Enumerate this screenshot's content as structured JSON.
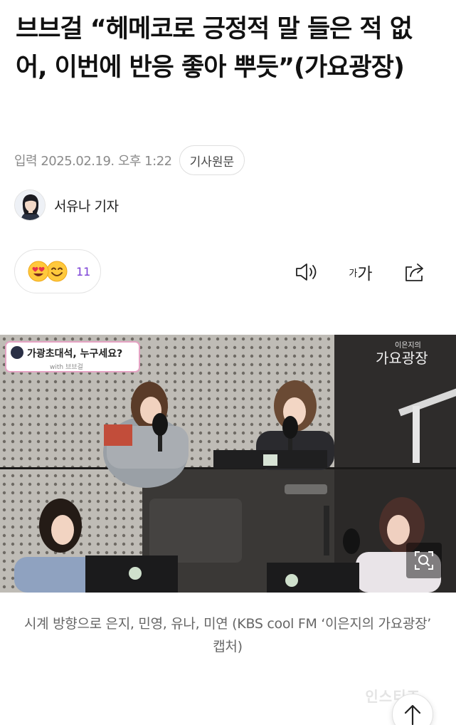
{
  "article": {
    "headline": "브브걸 “헤메코로 긍정적 말 들은 적 없어, 이번에 반응 좋아 뿌듯”(가요광장)",
    "date": "입력 2025.02.19. 오후 1:22",
    "source_button": "기사원문"
  },
  "author": {
    "name": "서유나 기자",
    "avatar_icon": "reporter-avatar"
  },
  "reactions": {
    "count": "11",
    "emoji_icons": [
      "heart-eyes-emoji-icon",
      "grinning-emoji-icon"
    ]
  },
  "toolbar": {
    "audio_icon": "speaker-icon",
    "font_small": "가",
    "font_large": "가",
    "share_icon": "share-icon"
  },
  "photo": {
    "broadcast_banner": "가광초대석, 누구세요?",
    "banner_sub": "with 브브걸",
    "studio_logo_top": "이은지의",
    "studio_logo": "가요광장",
    "zoom_icon": "zoom-icon"
  },
  "caption": "시계 방향으로 은지, 민영, 유나, 미연 (KBS cool FM ‘이은지의 가요광장’ 캡처)",
  "watermark": "인스티즈",
  "scroll_top_icon": "arrow-up-icon",
  "colors": {
    "reaction_count": "#7a3fd6",
    "meta_gray": "#8a8a8a",
    "caption_gray": "#666666"
  }
}
